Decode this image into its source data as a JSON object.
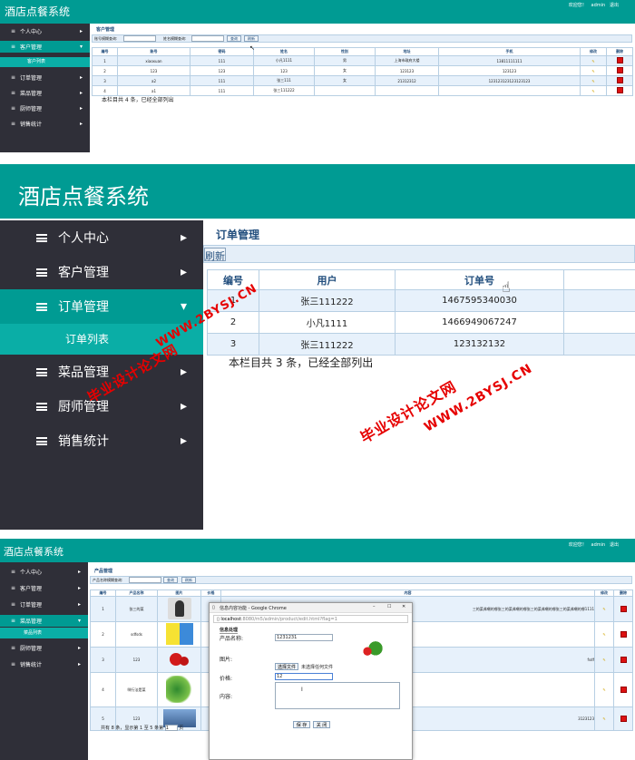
{
  "app_title": "酒店点餐系统",
  "header": {
    "welcome": "欢迎您！",
    "user": "admin",
    "logout": "退出"
  },
  "sidebar": {
    "personal": "个人中心",
    "customers": "客户管理",
    "customer_list": "客户列表",
    "orders": "订单管理",
    "order_list": "订单列表",
    "dishes": "菜品管理",
    "dish_list": "菜品列表",
    "chefs": "厨师管理",
    "sales": "销售统计"
  },
  "customer": {
    "title": "客户管理",
    "search_account_label": "账号模糊查询:",
    "search_name_label": "姓名模糊查询:",
    "query": "查询",
    "refresh": "刷新",
    "columns": [
      "编号",
      "账号",
      "密码",
      "姓名",
      "性别",
      "地址",
      "手机",
      "修改",
      "删除"
    ],
    "rows": [
      [
        "1",
        "xiaoxuan",
        "111",
        "小凡1111",
        "男",
        "上海市政府大楼",
        "13811111111"
      ],
      [
        "2",
        "123",
        "123",
        "123",
        "女",
        "123123",
        "123123"
      ],
      [
        "3",
        "a2",
        "111",
        "张三111",
        "女",
        "21312312",
        "123123123123123123"
      ],
      [
        "4",
        "a1",
        "111",
        "张三111222",
        "",
        "",
        ""
      ]
    ],
    "footer": "本栏目共 4 条，已经全部列出"
  },
  "order": {
    "title": "订单管理",
    "refresh": "刷新",
    "columns": [
      "编号",
      "用户",
      "订单号"
    ],
    "rows": [
      [
        "1",
        "张三111222",
        "1467595340030"
      ],
      [
        "2",
        "小凡1111",
        "1466949067247"
      ],
      [
        "3",
        "张三111222",
        "123132132"
      ]
    ],
    "footer": "本栏目共 3 条，已经全部列出"
  },
  "product": {
    "title": "产品管理",
    "search_label": "产品名称模糊查询:",
    "query": "查询",
    "refresh": "刷新",
    "columns": [
      "编号",
      "产品名称",
      "图片",
      "价格",
      "内容",
      "修改",
      "删除"
    ],
    "rows": [
      [
        "1",
        "张三的菜"
      ],
      [
        "2",
        "sdfsds"
      ],
      [
        "3",
        "123"
      ],
      [
        "4",
        "咪行法是菜"
      ],
      [
        "5",
        "123"
      ]
    ],
    "row1_content": "三的菜弗嘲的哪张三的菜弗嘲的哪张三的菜弗嘲的哪张三的菜弗嘲的哪1111",
    "row3_content": "fsdf",
    "row5_content": "3123123",
    "footer_total": "共有 8 条，显示第 1 至 5 条第",
    "footer_page_value": "1",
    "footer_page": "页"
  },
  "popup": {
    "title": "信息内容功能 - Google Chrome",
    "url_host": "localhost",
    "url_rest": ":8080/m5/admin/product/edit.html?flag=1",
    "section": "信息处理",
    "name_label": "产品名称:",
    "name_value": "1231231",
    "image_label": "图片:",
    "choose_file": "选择文件",
    "no_file": "未选择任何文件",
    "price_label": "价格:",
    "price_value": "12",
    "content_label": "内容:",
    "save": "保 存",
    "close": "关 闭"
  },
  "watermark": {
    "cn": "毕业设计论文网",
    "url": "WWW.2BYSJ.CN"
  },
  "colors": {
    "teal": "#009b93",
    "sidebar": "#2f2f38",
    "table_header": "#234f7e",
    "alt_row": "#e7f1fb"
  }
}
